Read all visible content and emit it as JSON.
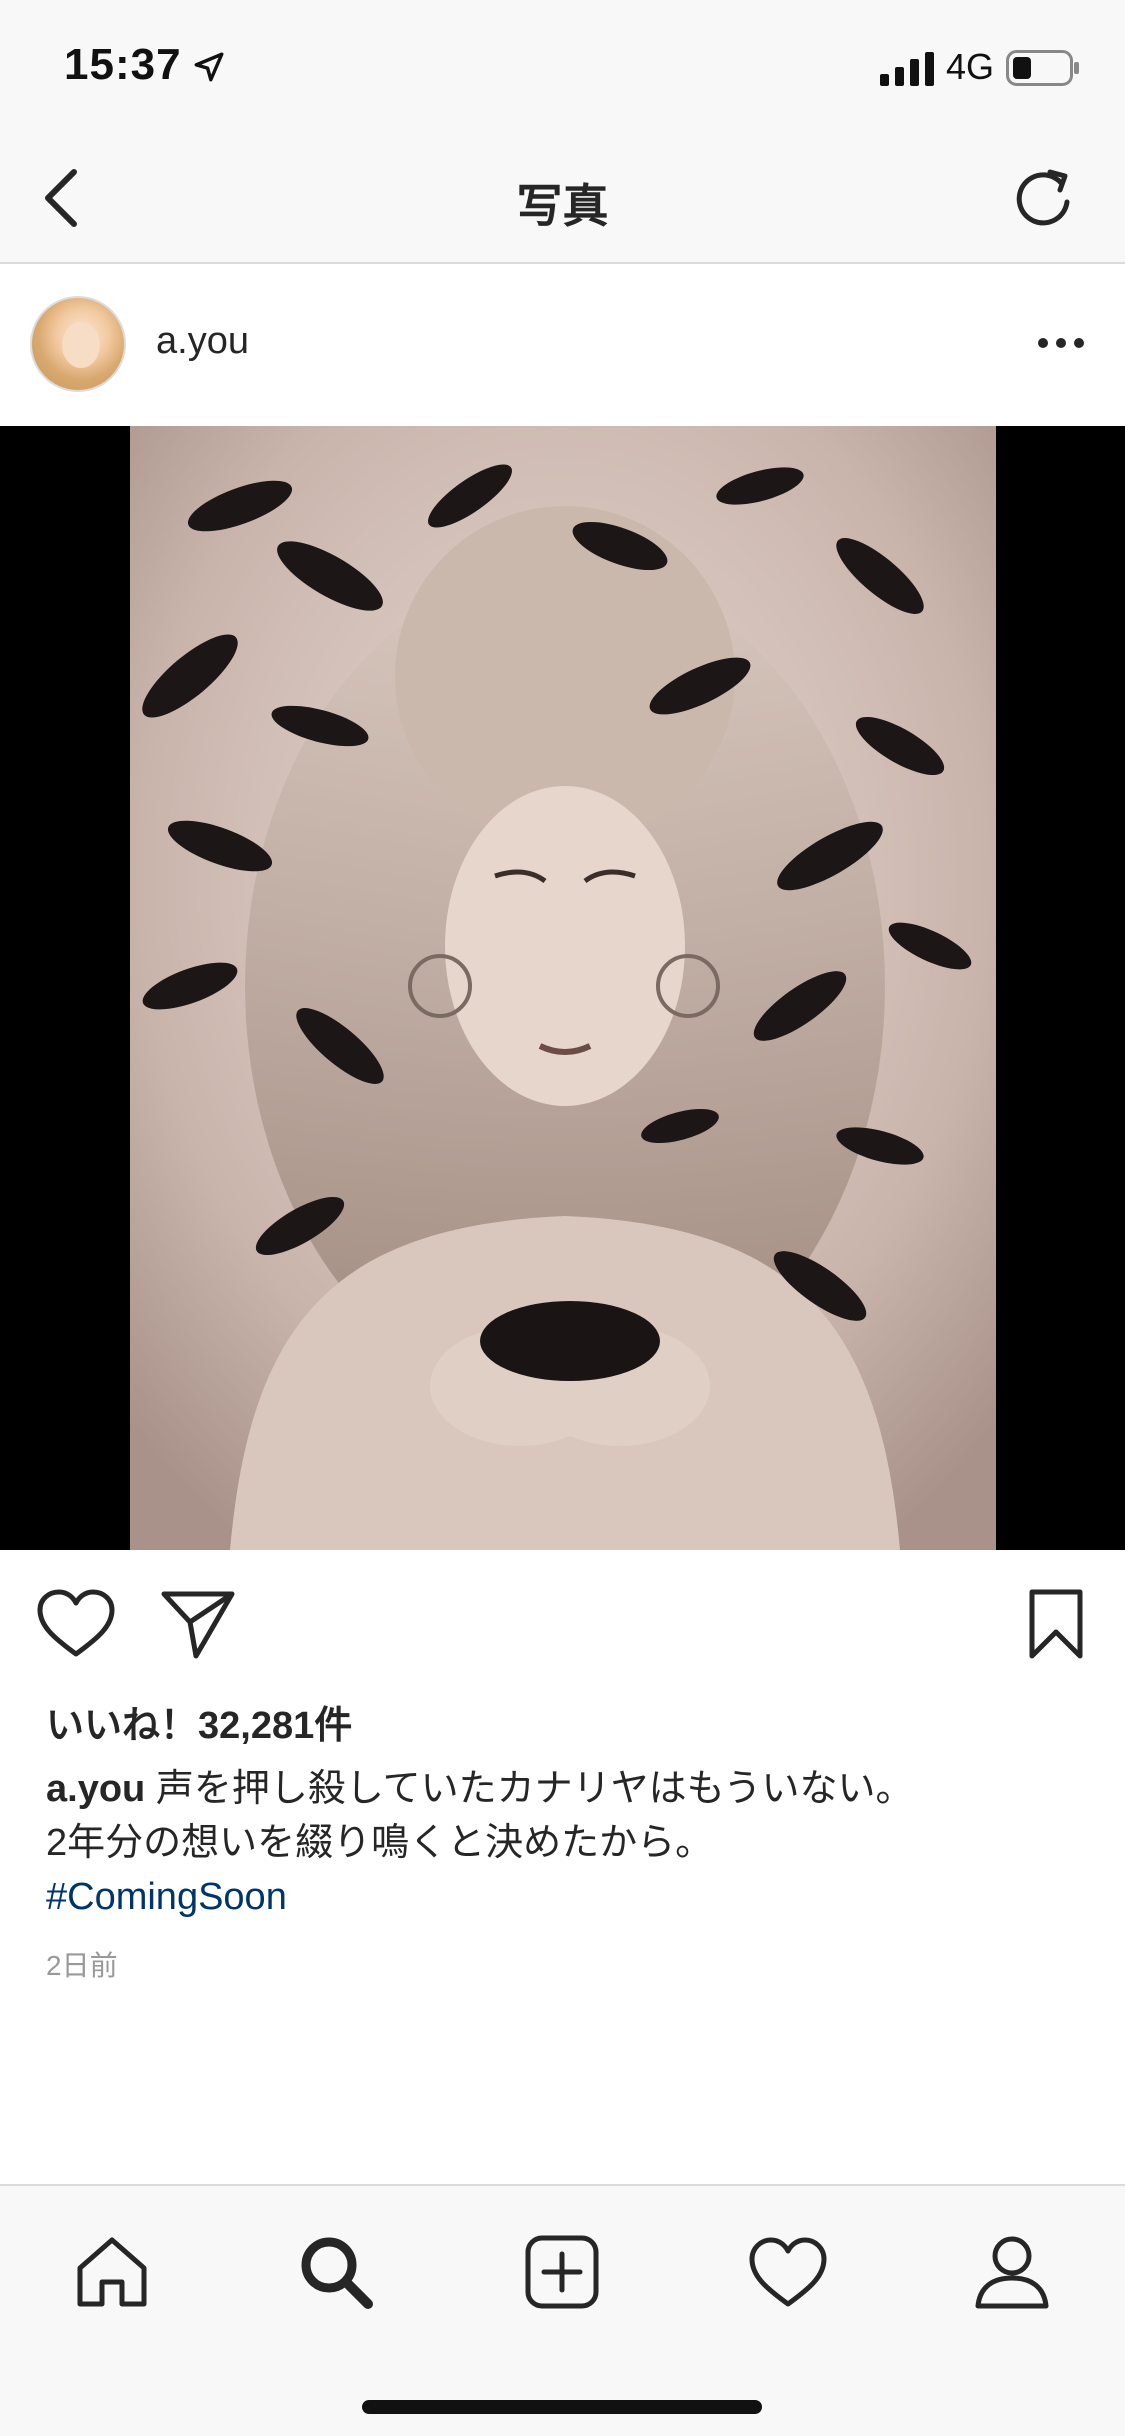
{
  "status_bar": {
    "time": "15:37",
    "network": "4G",
    "icons": [
      "location-arrow-icon",
      "signal-bars-icon",
      "battery-icon"
    ]
  },
  "nav": {
    "title": "写真",
    "icons": [
      "back-chevron-icon",
      "refresh-icon"
    ]
  },
  "post": {
    "username": "a.you",
    "likes_text": "いいね！32,281件",
    "caption_username": "a.you",
    "caption_line1": "声を押し殺していたカナリヤはもういない。",
    "caption_line2": "2年分の想いを綴り鳴くと決めたから。",
    "hashtag": "#ComingSoon",
    "time_ago": "2日前",
    "icons": [
      "avatar",
      "more-dots-icon",
      "heart-icon",
      "send-icon",
      "bookmark-icon"
    ]
  },
  "tab_bar": {
    "icons": [
      "home-icon",
      "search-icon",
      "add-post-icon",
      "activity-heart-icon",
      "profile-icon"
    ],
    "active": "search-icon"
  },
  "colors": {
    "bar_background": "#f8f8f8",
    "text": "#262626",
    "hashtag": "#003569",
    "secondary": "#999999",
    "divider": "#dbdbdb"
  }
}
